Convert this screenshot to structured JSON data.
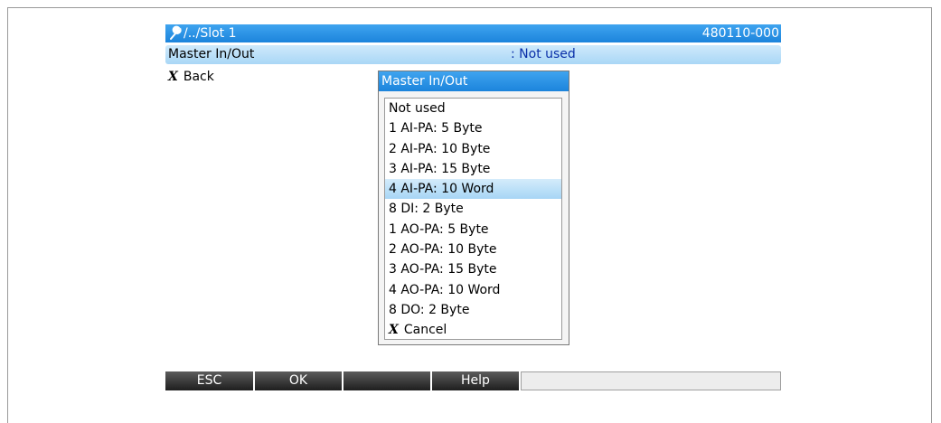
{
  "header": {
    "path": "/../Slot 1",
    "device_code": "480110-000",
    "icon": "wrench-icon"
  },
  "setting_row": {
    "label": "Master In/Out",
    "value": ": Not used"
  },
  "back": {
    "label": "Back",
    "icon": "x-icon"
  },
  "popup": {
    "title": "Master In/Out",
    "selected_index": 4,
    "items": [
      "Not used",
      "1 AI-PA: 5 Byte",
      "2 AI-PA: 10 Byte",
      "3 AI-PA: 15 Byte",
      "4 AI-PA: 10 Word",
      "8 DI: 2 Byte",
      "1 AO-PA: 5 Byte",
      "2 AO-PA: 10 Byte",
      "3 AO-PA: 15 Byte",
      "4 AO-PA: 10 Word",
      "8 DO: 2 Byte"
    ],
    "cancel_label": "Cancel"
  },
  "toolbar": {
    "esc": "ESC",
    "ok": "OK",
    "blank": "",
    "help": "Help"
  },
  "colors": {
    "title_blue": "#1c84dc",
    "selection_light_blue": "#a9d7f6",
    "value_text": "#0a2fa8"
  }
}
